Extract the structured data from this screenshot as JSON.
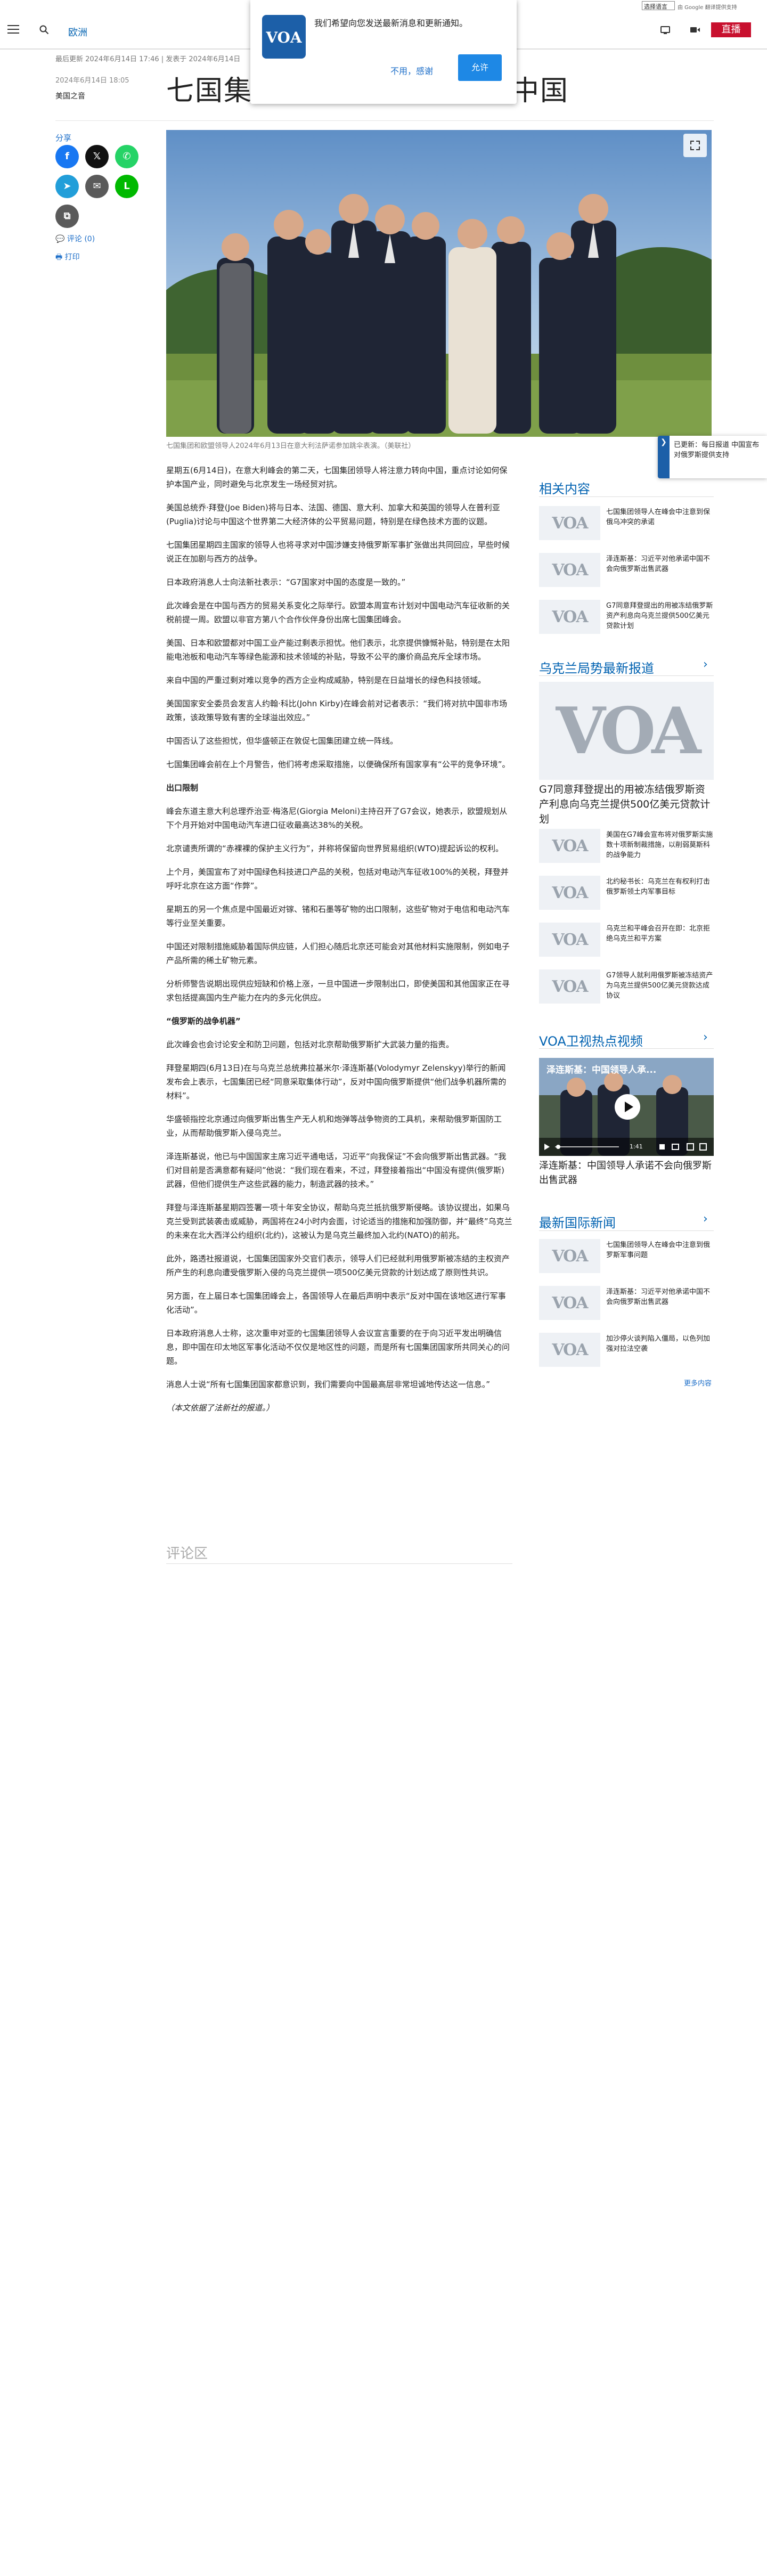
{
  "translate": {
    "select_value": "选择语言",
    "powered": "由 Google 翻译提供支持"
  },
  "header": {
    "section": "欧洲",
    "live": "直播"
  },
  "push": {
    "message": "我们希望向您发送最新消息和更新通知。",
    "deny": "不用，感谢",
    "allow": "允许"
  },
  "meta": {
    "updated": "最后更新 2024年6月14日 17:46 | 发表于 2024年6月14日",
    "date": "2024年6月14日 18:05",
    "source": "美国之音"
  },
  "title": "七国集团峰会将注意力转向中国",
  "share": {
    "label": "分享",
    "comments": "评论 (0)",
    "print": "打印",
    "buttons": [
      {
        "name": "facebook",
        "glyph": "f",
        "color": "#1877f2"
      },
      {
        "name": "x",
        "glyph": "𝕏",
        "color": "#111111"
      },
      {
        "name": "whatsapp",
        "glyph": "✆",
        "color": "#25d366"
      },
      {
        "name": "telegram",
        "glyph": "➤",
        "color": "#229ed9"
      },
      {
        "name": "email",
        "glyph": "✉",
        "color": "#5a5a5a"
      },
      {
        "name": "line",
        "glyph": "L",
        "color": "#00b900"
      },
      {
        "name": "copy-link",
        "glyph": "⧉",
        "color": "#5a5a5a"
      }
    ]
  },
  "caption": "七国集团和欧盟领导人2024年6月13日在意大利法萨诺参加跳伞表演。（美联社）",
  "article": [
    {
      "style": "normal",
      "text": "星期五(6月14日)，在意大利峰会的第二天，七国集团领导人将注意力转向中国，重点讨论如何保护本国产业，同时避免与北京发生一场经贸对抗。"
    },
    {
      "style": "normal",
      "text": "美国总统乔·拜登(Joe Biden)将与日本、法国、德国、意大利、加拿大和英国的领导人在普利亚(Puglia)讨论与中国这个世界第二大经济体的公平贸易问题，特别是在绿色技术方面的议题。"
    },
    {
      "style": "normal",
      "text": "七国集团星期四主国家的领导人也将寻求对中国涉嫌支持俄罗斯军事扩张做出共同回应，早些时候说正在加剧与西方的战争。"
    },
    {
      "style": "normal",
      "text": "日本政府消息人士向法新社表示：“G7国家对中国的态度是一致的。”"
    },
    {
      "style": "normal",
      "text": "此次峰会是在中国与西方的贸易关系变化之际举行。欧盟本周宣布计划对中国电动汽车征收新的关税前提一周。欧盟以非官方第八个合作伙伴身份出席七国集团峰会。"
    },
    {
      "style": "normal",
      "text": "美国、日本和欧盟都对中国工业产能过剩表示担忧。他们表示，北京提供慷慨补贴，特别是在太阳能电池板和电动汽车等绿色能源和技术领域的补贴，导致不公平的廉价商品充斥全球市场。"
    },
    {
      "style": "normal",
      "text": "来自中国的严重过剩对难以竞争的西方企业构成威胁，特别是在日益增长的绿色科技领域。"
    },
    {
      "style": "normal",
      "text": "美国国家安全委员会发言人约翰·科比(John Kirby)在峰会前对记者表示：“我们将对抗中国非市场政策，该政策导致有害的全球溢出效应。”"
    },
    {
      "style": "normal",
      "text": "中国否认了这些担忧，但华盛顿正在敦促七国集团建立统一阵线。"
    },
    {
      "style": "normal",
      "text": "七国集团峰会前在上个月警告，他们将考虑采取措施，以便确保所有国家享有“公平的竞争环境”。"
    },
    {
      "style": "bold",
      "text": "出口限制"
    },
    {
      "style": "normal",
      "text": "峰会东道主意大利总理乔治亚·梅洛尼(Giorgia Meloni)主持召开了G7会议，她表示，欧盟规划从下个月开始对中国电动汽车进口征收最高达38%的关税。"
    },
    {
      "style": "normal",
      "text": "北京谴责所谓的“赤裸裸的保护主义行为”，并称将保留向世界贸易组织(WTO)提起诉讼的权利。"
    },
    {
      "style": "normal",
      "text": "上个月，美国宣布了对中国绿色科技进口产品的关税，包括对电动汽车征收100%的关税，拜登并呼吁北京在这方面“作弊”。"
    },
    {
      "style": "normal",
      "text": "星期五的另一个焦点是中国最近对镓、锗和石墨等矿物的出口限制，这些矿物对于电信和电动汽车等行业至关重要。"
    },
    {
      "style": "normal",
      "text": "中国还对限制措施威胁着国际供应链，人们担心随后北京还可能会对其他材料实施限制，例如电子产品所需的稀土矿物元素。"
    },
    {
      "style": "normal",
      "text": "分析师警告说期出现供应短缺和价格上涨，一旦中国进一步限制出口，即使美国和其他国家正在寻求包括提高国内生产能力在内的多元化供应。"
    },
    {
      "style": "bold",
      "text": "“俄罗斯的战争机器”"
    },
    {
      "style": "normal",
      "text": "此次峰会也会讨论安全和防卫问题，包括对北京帮助俄罗斯扩大武装力量的指责。"
    },
    {
      "style": "normal",
      "text": "拜登星期四(6月13日)在与乌克兰总统弗拉基米尔·泽连斯基(Volodymyr Zelenskyy)举行的新闻发布会上表示，七国集团已经“同意采取集体行动”，反对中国向俄罗斯提供“他们战争机器所需的材料”。"
    },
    {
      "style": "normal",
      "text": "华盛顿指控北京通过向俄罗斯出售生产无人机和炮弹等战争物资的工具机，来帮助俄罗斯国防工业，从而帮助俄罗斯入侵乌克兰。"
    },
    {
      "style": "normal",
      "text": "泽连斯基说，他已与中国国家主席习近平通电话，习近平“向我保证”不会向俄罗斯出售武器。“我们对目前是否满意都有疑问”他说：“我们现在看来，不过，拜登接着指出“中国没有提供(俄罗斯)武器，但他们提供生产这些武器的能力，制造武器的技术。”"
    },
    {
      "style": "normal",
      "text": "拜登与泽连斯基星期四签署一项十年安全协议，帮助乌克兰抵抗俄罗斯侵略。该协议提出，如果乌克兰受到武装袭击或威胁，两国将在24小时内会面，讨论适当的措施和加强防御，并“最终”乌克兰的未来在北大西洋公约组织(北约)，这被认为是乌克兰最终加入北约(NATO)的前兆。"
    },
    {
      "style": "normal",
      "text": "此外，路透社报道说，七国集团国家外交官们表示，领导人们已经就利用俄罗斯被冻结的主权资产所产生的利息向遭受俄罗斯入侵的乌克兰提供一项500亿美元贷款的计划达成了原则性共识。"
    },
    {
      "style": "normal",
      "text": "另方面，在上届日本七国集团峰会上，各国领导人在最后声明中表示“反对中国在该地区进行军事化活动”。"
    },
    {
      "style": "normal",
      "text": "日本政府消息人士称，这次重申对亚的七国集团领导人会议宣言重要的在于向习近平发出明确信息，即中国在印太地区军事化活动不仅仅是地区性的问题，而是所有七国集团国家所共同关心的问题。"
    },
    {
      "style": "normal",
      "text": "消息人士说“所有七国集团国家都意识到，我们需要向中国最高层非常坦诚地传达这一信息。”"
    },
    {
      "style": "italic",
      "text": "（本文依据了法新社的报道。）"
    }
  ],
  "comments_section": "评论区",
  "sidebar": {
    "related_head": "相关内容",
    "related": [
      "七国集团领导人在峰会中注意到保俄乌冲突的承诺",
      "泽连斯基：习近平对他承诺中国不会向俄罗斯出售武器",
      "G7同意拜登提出的用被冻结俄罗斯资产利息向乌克兰提供500亿美元贷款计划"
    ],
    "ukraine_head": "乌克兰局势最新报道",
    "ukraine_feature": "G7同意拜登提出的用被冻结俄罗斯资产利息向乌克兰提供500亿美元贷款计划",
    "ukraine": [
      "美国在G7峰会宣布将对俄罗斯实施数十项新制裁措施，以削弱莫斯科的战争能力",
      "北约秘书长：乌克兰在有权利打击俄罗斯领土内军事目标",
      "乌克兰和平峰会召开在即：北京拒绝乌克兰和平方案",
      "G7领导人就利用俄罗斯被冻结资产为乌克兰提供500亿美元贷款达成协议"
    ],
    "video_head": "VOA卫视热点视频",
    "video_title": "泽连斯基：中国领导人承诺不会向俄罗斯出售武器",
    "video_overlay": "泽连斯基：中国领导人承...",
    "video_time": "1:41",
    "intl_head": "最新国际新闻",
    "intl": [
      "七国集团领导人在峰会中注意到俄罗斯军事问题",
      "泽连斯基：习近平对他承诺中国不会向俄罗斯出售武器",
      "加沙停火谈判陷入僵局，以色列加强对拉法空袭"
    ],
    "more": "更多内容"
  },
  "widget": {
    "tab": "❯",
    "text": "已更新：每日报道 中国宣布对俄罗斯提供支持"
  }
}
